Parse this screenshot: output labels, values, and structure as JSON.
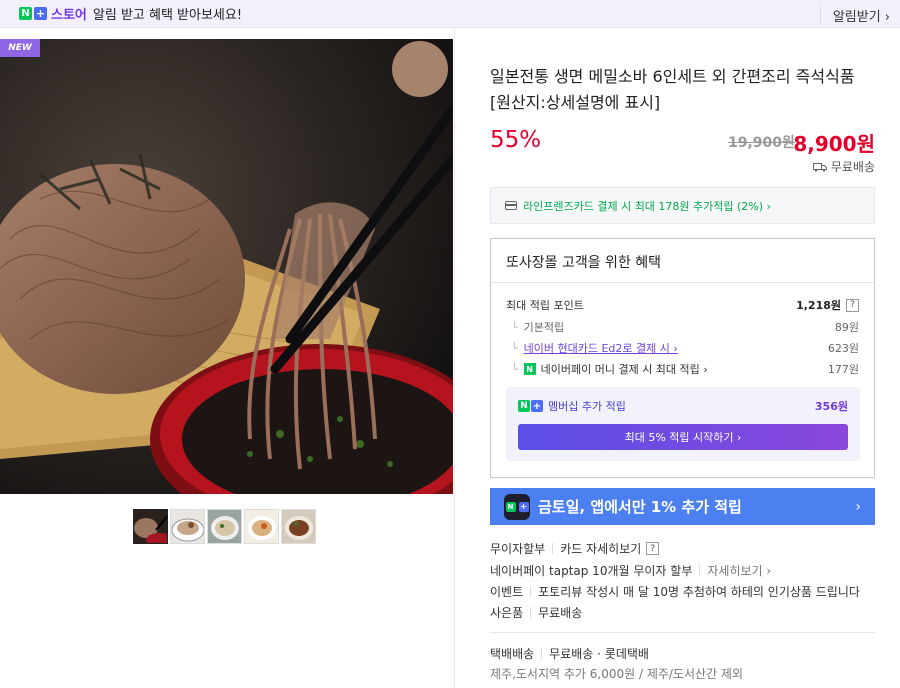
{
  "topbar": {
    "badge_n": "N",
    "badge_plus": "+",
    "store": "스토어",
    "message": "알림 받고 혜택 받아보세요!",
    "right": "알림받기 ›"
  },
  "gallery": {
    "new_tag": "NEW",
    "thumbnails": [
      "thumb-1",
      "thumb-2",
      "thumb-3",
      "thumb-4",
      "thumb-5"
    ]
  },
  "product": {
    "title": "일본전통 생면 메밀소바 6인세트 외 간편조리 즉석식품 [원산지:상세설명에 표시]",
    "discount": "55%",
    "original_price": "19,900원",
    "price": "8,900원",
    "shipping": "무료배송"
  },
  "card_offer": {
    "text": "라인프렌즈카드 결제 시 최대 178원 추가적립 (2%) ›"
  },
  "benefit": {
    "header": "또사장몰 고객을 위한 혜택",
    "max_point_label": "최대 적립 포인트",
    "max_point_value": "1,218원",
    "help": "?",
    "rows": [
      {
        "label": "기본적립",
        "value": "89원"
      },
      {
        "label": "네이버 현대카드 Ed2로 결제 시 ›",
        "value": "623원"
      },
      {
        "label": "네이버페이 머니 결제 시 최대 적립 ›",
        "value": "177원"
      }
    ],
    "membership_label": "멤버십 추가 적립",
    "membership_value": "356원",
    "membership_button": "최대 5% 적립 시작하기 ›"
  },
  "promo": {
    "text": "금토일, 앱에서만 1% 추가 적립",
    "arrow": "›"
  },
  "info": {
    "installment_label": "무이자할부",
    "installment_link": "카드 자세히보기",
    "installment_help": "?",
    "npay_text": "네이버페이 taptap 10개월 무이자 할부",
    "npay_link": "자세히보기 ›",
    "event_label": "이벤트",
    "event_text": "포토리뷰 작성시 매 달 10명 추첨하여 하테의 인기상품 드립니다",
    "gift_label": "사은품",
    "gift_text": "무료배송",
    "delivery_label": "택배배송",
    "delivery_text": "무료배송 · 롯데택배",
    "delivery_extra": "제주,도서지역 추가 6,000원 / 제주/도서산간 제외"
  },
  "colors": {
    "accent_red": "#e4002b",
    "naver_green": "#03c75a",
    "purple": "#6f3ae0",
    "promo_blue": "#4c7ff0"
  }
}
